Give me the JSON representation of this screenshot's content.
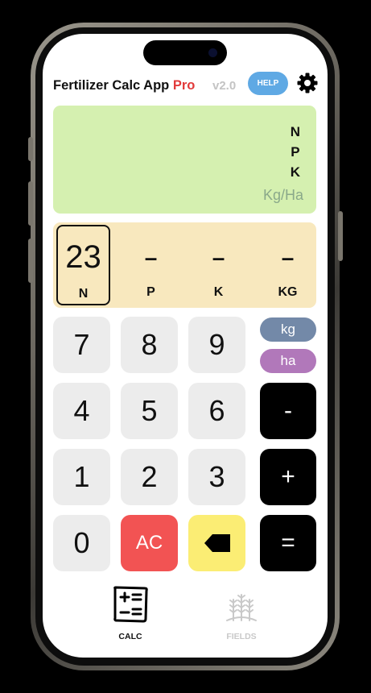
{
  "header": {
    "app_name": "Fertilizer Calc App",
    "pro_label": "Pro",
    "version": "v2.0",
    "help_label": "HELP"
  },
  "display": {
    "npk": [
      "N",
      "P",
      "K"
    ],
    "unit": "Kg/Ha"
  },
  "values": [
    {
      "value": "23",
      "label": "N",
      "active": true
    },
    {
      "value": "–",
      "label": "P",
      "active": false
    },
    {
      "value": "–",
      "label": "K",
      "active": false
    },
    {
      "value": "–",
      "label": "KG",
      "active": false
    }
  ],
  "keypad": {
    "digits": [
      "7",
      "8",
      "9",
      "4",
      "5",
      "6",
      "1",
      "2",
      "3",
      "0"
    ],
    "clear": "AC",
    "minus": "-",
    "plus": "+",
    "equals": "=",
    "unit_kg": "kg",
    "unit_ha": "ha"
  },
  "tabs": [
    {
      "label": "CALC",
      "icon": "calculator-icon",
      "active": true
    },
    {
      "label": "FIELDS",
      "icon": "wheat-icon",
      "active": false
    }
  ],
  "colors": {
    "display_bg": "#d5f0b0",
    "values_bg": "#f8e8be",
    "help": "#5fa9e4",
    "pro": "#e23a3a",
    "ac": "#f25353",
    "backspace": "#fbed74",
    "kg_pill": "#7389a8",
    "ha_pill": "#b178ba"
  }
}
